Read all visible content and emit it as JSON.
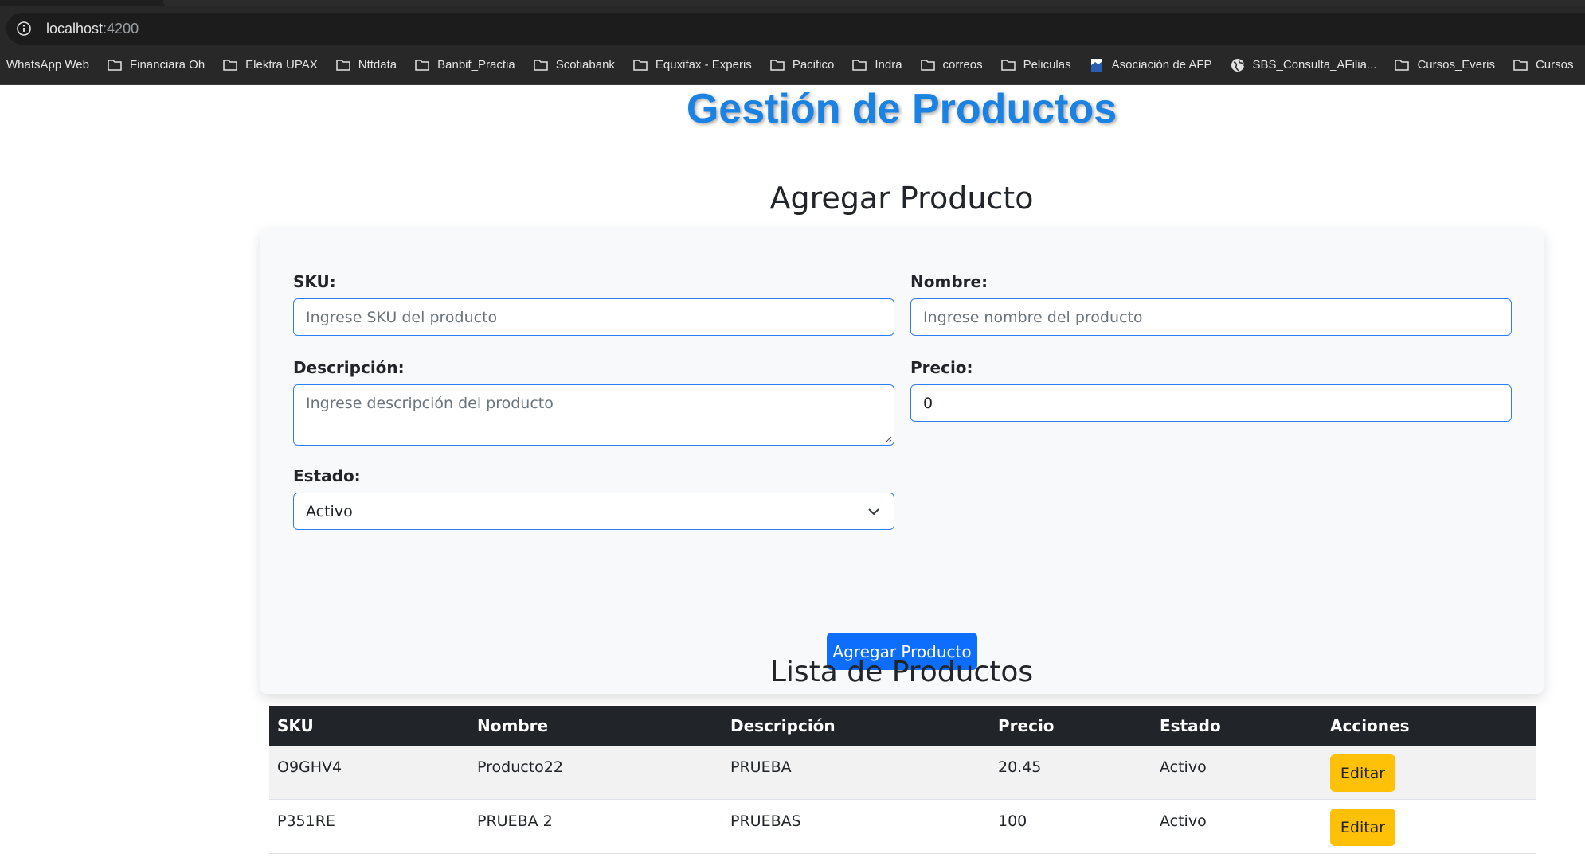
{
  "browser": {
    "url_host": "localhost",
    "url_port": ":4200",
    "bookmarks": [
      {
        "label": "WhatsApp Web",
        "icon": "none"
      },
      {
        "label": "Financiara Oh",
        "icon": "folder-icon"
      },
      {
        "label": "Elektra UPAX",
        "icon": "folder-icon"
      },
      {
        "label": "Nttdata",
        "icon": "folder-icon"
      },
      {
        "label": "Banbif_Practia",
        "icon": "folder-icon"
      },
      {
        "label": "Scotiabank",
        "icon": "folder-icon"
      },
      {
        "label": "Equxifax - Experis",
        "icon": "folder-icon"
      },
      {
        "label": "Pacifico",
        "icon": "folder-icon"
      },
      {
        "label": "Indra",
        "icon": "folder-icon"
      },
      {
        "label": "correos",
        "icon": "folder-icon"
      },
      {
        "label": "Peliculas",
        "icon": "folder-icon"
      },
      {
        "label": "Asociación de AFP",
        "icon": "page-icon"
      },
      {
        "label": "SBS_Consulta_AFilia...",
        "icon": "globe-icon"
      },
      {
        "label": "Cursos_Everis",
        "icon": "folder-icon"
      },
      {
        "label": "Cursos",
        "icon": "folder-icon"
      }
    ]
  },
  "header": {
    "title": "Gestión de Productos"
  },
  "form": {
    "title": "Agregar Producto",
    "sku_label": "SKU:",
    "sku_placeholder": "Ingrese SKU del producto",
    "nombre_label": "Nombre:",
    "nombre_placeholder": "Ingrese nombre del producto",
    "descripcion_label": "Descripción:",
    "descripcion_placeholder": "Ingrese descripción del producto",
    "precio_label": "Precio:",
    "precio_value": "0",
    "estado_label": "Estado:",
    "estado_value": "Activo",
    "submit_label": "Agregar Producto"
  },
  "list": {
    "title": "Lista de Productos",
    "columns": [
      "SKU",
      "Nombre",
      "Descripción",
      "Precio",
      "Estado",
      "Acciones"
    ],
    "rows": [
      {
        "sku": "O9GHV4",
        "nombre": "Producto22",
        "descripcion": "PRUEBA",
        "precio": "20.45",
        "estado": "Activo",
        "accion": "Editar"
      },
      {
        "sku": "P351RE",
        "nombre": "PRUEBA 2",
        "descripcion": "PRUEBAS",
        "precio": "100",
        "estado": "Activo",
        "accion": "Editar"
      }
    ]
  },
  "colors": {
    "title_blue": "#1a82e2",
    "primary": "#0d6efd",
    "warning": "#ffc107",
    "table_header": "#212529"
  }
}
